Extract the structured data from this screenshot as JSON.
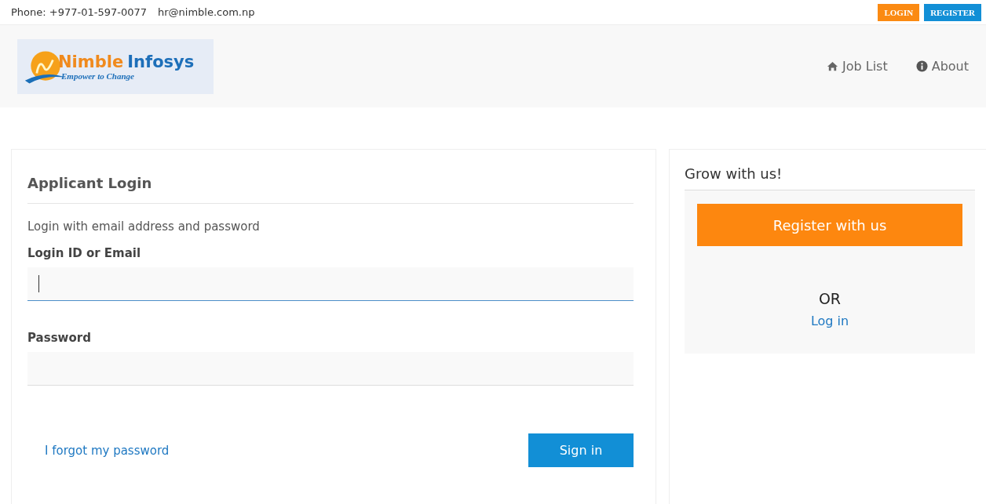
{
  "top_bar": {
    "phone": "Phone: +977-01-597-0077",
    "email": "hr@nimble.com.np",
    "buttons": [
      {
        "label": "LOGIN",
        "kind": "login"
      },
      {
        "label": "REGISTER",
        "kind": "register"
      }
    ]
  },
  "header": {
    "logo": {
      "name_1": "Nimble",
      "name_2": "Infosys",
      "tagline": "Empower to Change"
    },
    "nav": [
      {
        "label": "Job List",
        "kind": "home"
      },
      {
        "label": "About",
        "kind": "info"
      }
    ]
  },
  "login_panel": {
    "title": "Applicant Login",
    "intro": "Login with email address and password",
    "fields": [
      {
        "label": "Login ID or Email",
        "focused": true
      },
      {
        "label": "Password",
        "focused": false
      }
    ],
    "forgot_link": "I forgot my password",
    "submit": "Sign in"
  },
  "side_panel": {
    "title": "Grow with us!",
    "register_button": "Register with us",
    "or": "OR",
    "login_link": "Log in"
  }
}
